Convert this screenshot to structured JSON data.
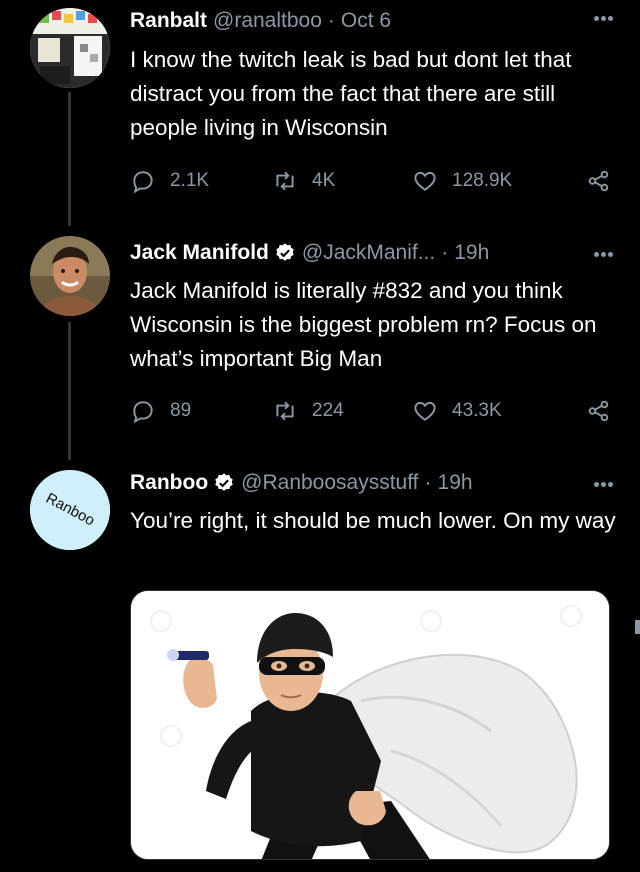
{
  "tweets": [
    {
      "name": "Ranbalt",
      "handle": "@ranaltboo",
      "separator": "·",
      "time": "Oct 6",
      "text": "I know the twitch leak is bad but dont let that distract you from the fact that there are still people living in Wisconsin",
      "replies": "2.1K",
      "retweets": "4K",
      "likes": "128.9K",
      "verified": false
    },
    {
      "name": "Jack Manifold",
      "handle": "@JackManif...",
      "separator": "·",
      "time": "19h",
      "text": "Jack Manifold is literally #832 and you think Wisconsin is the biggest problem rn? Focus on what’s important Big Man",
      "replies": "89",
      "retweets": "224",
      "likes": "43.3K",
      "verified": true
    },
    {
      "name": "Ranboo",
      "handle": "@Ranboosaysstuff",
      "separator": "·",
      "time": "19h",
      "text": "You’re right, it should be much lower. On my way",
      "verified": true,
      "avatar_text": "Ranboo"
    }
  ],
  "colors": {
    "background": "#000000",
    "secondary_text": "#8b98a5",
    "verified_blue": "#ffffff",
    "thread_line": "#333639"
  },
  "icons": {
    "reply": "reply-icon",
    "retweet": "retweet-icon",
    "like": "heart-icon",
    "share": "share-icon",
    "more": "more-icon",
    "verified": "verified-badge-icon"
  }
}
